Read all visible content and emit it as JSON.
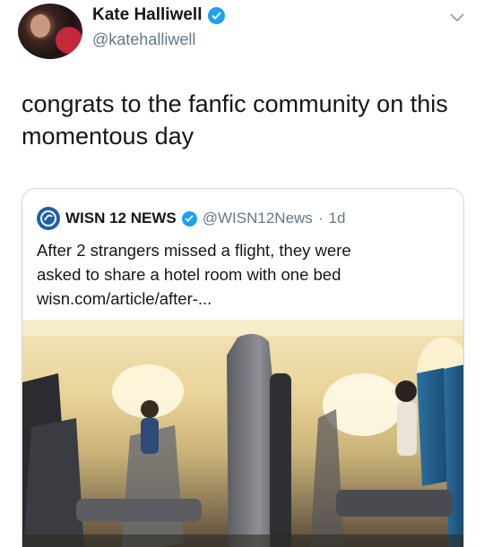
{
  "author": {
    "name": "Kate Halliwell",
    "handle": "@katehalliwell",
    "verified": true
  },
  "tweet": {
    "text_line1": "congrats to the fanfic community on this",
    "text_line2": "momentous day"
  },
  "quoted": {
    "name": "WISN 12 NEWS",
    "handle": "@WISN12News",
    "separator": "·",
    "age": "1d",
    "text_line1": "After 2 strangers missed a flight, they were",
    "text_line2": "asked to share a hotel room with one bed",
    "text_line3": "wisn.com/article/after-..."
  },
  "icons": {
    "verified": "verified-badge-icon",
    "menu": "chevron-down-icon",
    "logo": "wisn-logo-icon"
  },
  "colors": {
    "verified_blue": "#1da1f2",
    "secondary_text": "#657786",
    "primary_text": "#14171a"
  }
}
